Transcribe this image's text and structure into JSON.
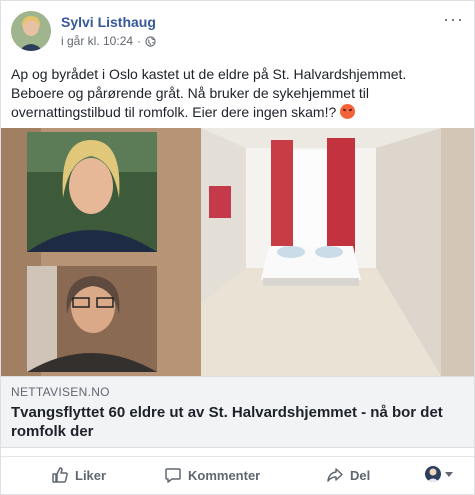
{
  "post": {
    "author": "Sylvi Listhaug",
    "timestamp": "i går kl. 10:24",
    "text": "Ap og byrådet i Oslo kastet ut de eldre på St. Halvardshjemmet. Beboere og pårørende gråt. Nå bruker de sykehjemmet til overnattingstilbud til romfolk. Eier dere ingen skam!?",
    "emoji": "angry-face-emoji",
    "more_icon": "more-icon",
    "privacy_icon": "globe-icon"
  },
  "link": {
    "domain": "NETTAVISEN.NO",
    "headline": "Tvangsflyttet 60 eldre ut av St. Halvardshjemmet - nå bor det romfolk der"
  },
  "actions": {
    "like": "Liker",
    "comment": "Kommenter",
    "share": "Del"
  },
  "colors": {
    "author": "#365899",
    "link_bg": "#f2f3f5",
    "action_text": "#606770"
  }
}
